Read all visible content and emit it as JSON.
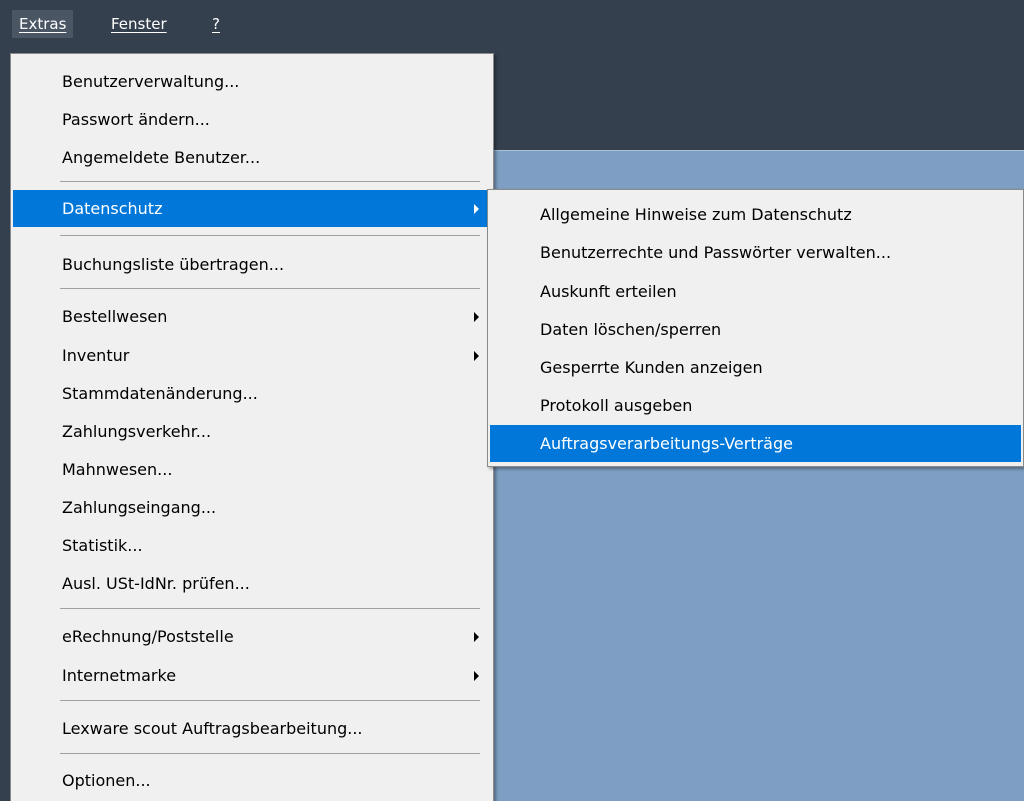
{
  "menubar": {
    "items": [
      "Extras",
      "Fenster",
      "?"
    ]
  },
  "extras_menu": {
    "items": [
      "Benutzerverwaltung...",
      "Passwort ändern...",
      "Angemeldete Benutzer...",
      "Datenschutz",
      "Buchungsliste übertragen...",
      "Bestellwesen",
      "Inventur",
      "Stammdatenänderung...",
      "Zahlungsverkehr...",
      "Mahnwesen...",
      "Zahlungseingang...",
      "Statistik...",
      "Ausl. USt-IdNr. prüfen...",
      "eRechnung/Poststelle",
      "Internetmarke",
      "Lexware scout Auftragsbearbeitung...",
      "Optionen..."
    ]
  },
  "datenschutz_submenu": {
    "items": [
      "Allgemeine Hinweise zum Datenschutz",
      "Benutzerrechte und Passwörter verwalten...",
      "Auskunft erteilen",
      "Daten löschen/sperren",
      "Gesperrte Kunden anzeigen",
      "Protokoll ausgeben",
      "Auftragsverarbeitungs-Verträge"
    ]
  },
  "colors": {
    "app_dark": "#34404e",
    "workspace_blue": "#7e9fc3",
    "highlight": "#0077d9",
    "menu_bg": "#f0f0f0"
  },
  "icons": [
    "submenu-arrow-icon"
  ]
}
